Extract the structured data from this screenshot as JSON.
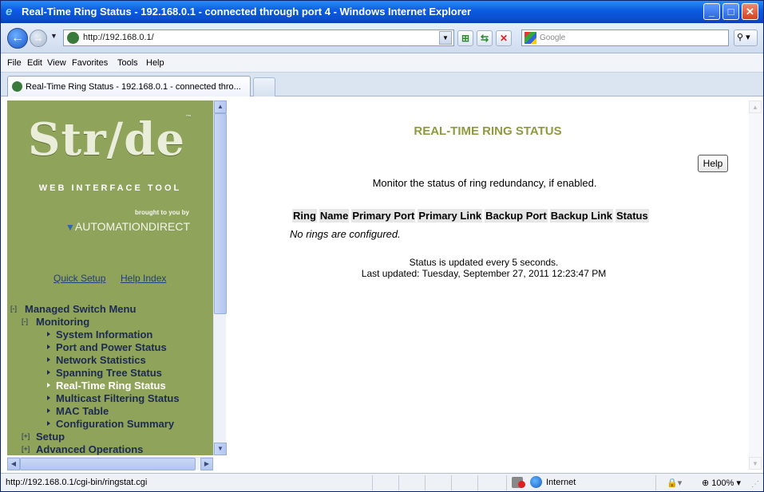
{
  "window": {
    "title": "Real-Time Ring Status - 192.168.0.1 - connected through port 4 - Windows Internet Explorer"
  },
  "nav": {
    "address": "http://192.168.0.1/",
    "search_placeholder": "Google"
  },
  "menubar": [
    "File",
    "Edit",
    "View",
    "Favorites",
    "Tools",
    "Help"
  ],
  "tabs": [
    {
      "label": "Real-Time Ring Status - 192.168.0.1 - connected thro..."
    }
  ],
  "sidebar": {
    "logo": "Str/de",
    "logo_tm": "™",
    "subtitle": "WEB INTERFACE TOOL",
    "brought_by": "brought to you by",
    "sponsor": "AUTOMATIONDIRECT",
    "links": [
      "Quick Setup",
      "Help Index"
    ],
    "menu": {
      "root_toggle": "[-]",
      "root": "Managed Switch Menu",
      "monitoring_toggle": "[-]",
      "monitoring": "Monitoring",
      "items": [
        "System Information",
        "Port and Power Status",
        "Network Statistics",
        "Spanning Tree Status",
        "Real-Time Ring Status",
        "Multicast Filtering Status",
        "MAC Table",
        "Configuration Summary"
      ],
      "selected_index": 4,
      "setup_toggle": "[+]",
      "setup": "Setup",
      "advanced_toggle": "[+]",
      "advanced": "Advanced Operations"
    }
  },
  "main": {
    "title": "REAL-TIME RING STATUS",
    "help_button": "Help",
    "description": "Monitor the status of ring redundancy, if enabled.",
    "table_headers": [
      "Ring",
      "Name",
      "Primary Port",
      "Primary Link",
      "Backup Port",
      "Backup Link",
      "Status"
    ],
    "empty_message": "No rings are configured.",
    "update_interval": "Status is updated every 5 seconds.",
    "last_updated": "Last updated: Tuesday, September 27, 2011 12:23:47 PM"
  },
  "statusbar": {
    "url": "http://192.168.0.1/cgi-bin/ringstat.cgi",
    "zone": "Internet",
    "zoom": "100%"
  }
}
